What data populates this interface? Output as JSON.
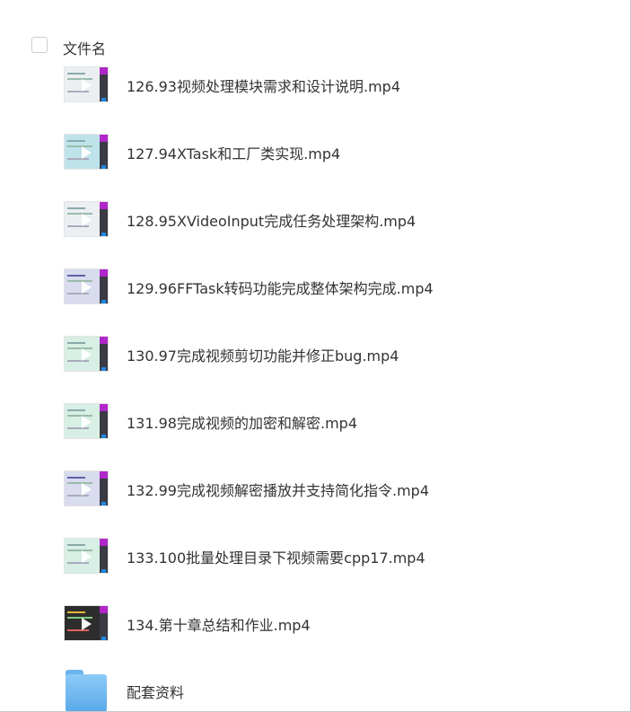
{
  "list": {
    "header_label": "文件名",
    "items": [
      {
        "name": "126.93视频处理模块需求和设计说明.mp4",
        "icon": "video-thumbnail-icon"
      },
      {
        "name": "127.94XTask和工厂类实现.mp4",
        "icon": "video-thumbnail-icon"
      },
      {
        "name": "128.95XVideoInput完成任务处理架构.mp4",
        "icon": "video-thumbnail-icon"
      },
      {
        "name": "129.96FFTask转码功能完成整体架构完成.mp4",
        "icon": "video-thumbnail-icon"
      },
      {
        "name": "130.97完成视频剪切功能并修正bug.mp4",
        "icon": "video-thumbnail-icon"
      },
      {
        "name": "131.98完成视频的加密和解密.mp4",
        "icon": "video-thumbnail-icon"
      },
      {
        "name": "132.99完成视频解密播放并支持简化指令.mp4",
        "icon": "video-thumbnail-icon"
      },
      {
        "name": "133.100批量处理目录下视频需要cpp17.mp4",
        "icon": "video-thumbnail-icon"
      },
      {
        "name": "134.第十章总结和作业.mp4",
        "icon": "video-thumbnail-icon"
      },
      {
        "name": "配套资料",
        "icon": "folder-icon"
      }
    ]
  },
  "colors": {
    "folder": "#5aa9ea",
    "thumbnail_accent": "#b126c9",
    "text": "#333333",
    "border": "#c8c8c8"
  }
}
